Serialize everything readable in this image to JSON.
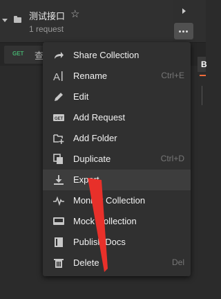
{
  "collection": {
    "name": "测试接口",
    "count": "1 request"
  },
  "request": {
    "method": "GET",
    "name": "查"
  },
  "side_tab": {
    "letter": "B"
  },
  "menu": {
    "items": [
      {
        "label": "Share Collection",
        "shortcut": "",
        "icon": "share-icon"
      },
      {
        "label": "Rename",
        "shortcut": "Ctrl+E",
        "icon": "rename-icon"
      },
      {
        "label": "Edit",
        "shortcut": "",
        "icon": "pencil-icon"
      },
      {
        "label": "Add Request",
        "shortcut": "",
        "icon": "get-request-icon"
      },
      {
        "label": "Add Folder",
        "shortcut": "",
        "icon": "add-folder-icon"
      },
      {
        "label": "Duplicate",
        "shortcut": "Ctrl+D",
        "icon": "duplicate-icon"
      },
      {
        "label": "Export",
        "shortcut": "",
        "icon": "download-icon"
      },
      {
        "label": "Monitor Collection",
        "shortcut": "",
        "icon": "monitor-icon"
      },
      {
        "label": "Mock Collection",
        "shortcut": "",
        "icon": "mock-server-icon"
      },
      {
        "label": "Publish Docs",
        "shortcut": "",
        "icon": "docs-icon"
      },
      {
        "label": "Delete",
        "shortcut": "Del",
        "icon": "trash-icon"
      }
    ]
  },
  "colors": {
    "accent": "#f26b3a",
    "get_method": "#46b06f",
    "annotation_arrow": "#e8302a"
  }
}
